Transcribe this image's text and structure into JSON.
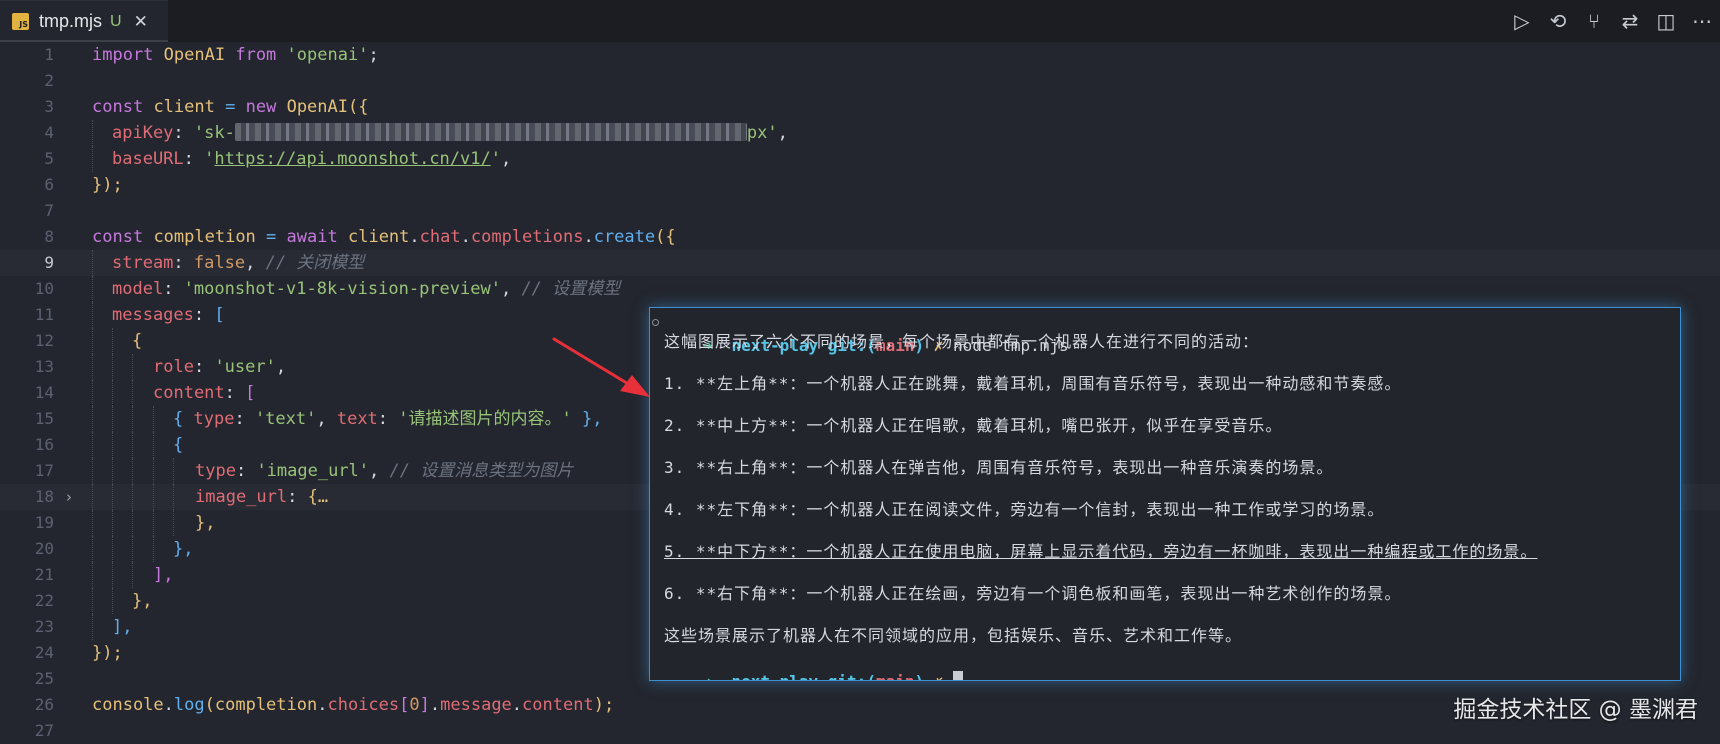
{
  "tab": {
    "icon_label": "JS",
    "filename": "tmp.mjs",
    "status": "U",
    "close_glyph": "✕"
  },
  "actions": [
    {
      "name": "run-icon",
      "glyph": "▷"
    },
    {
      "name": "history-icon",
      "glyph": "⟲"
    },
    {
      "name": "source-control-icon",
      "glyph": "⑂"
    },
    {
      "name": "compare-icon",
      "glyph": "⇄"
    },
    {
      "name": "split-editor-icon",
      "glyph": "◫"
    },
    {
      "name": "more-icon",
      "glyph": "⋯"
    }
  ],
  "editor": {
    "line_numbers": [
      "1",
      "2",
      "3",
      "4",
      "5",
      "6",
      "7",
      "8",
      "9",
      "10",
      "11",
      "12",
      "13",
      "14",
      "15",
      "16",
      "17",
      "18",
      "19",
      "20",
      "21",
      "22",
      "23",
      "24",
      "25",
      "26",
      "27",
      "28"
    ],
    "active_line": "9",
    "folded_line": "18",
    "code": {
      "l1": {
        "kw1": "import",
        "cls": "OpenAI",
        "kw2": "from",
        "str": "'openai'",
        "end": ";"
      },
      "l3": {
        "kw": "const",
        "var": "client",
        "op": "=",
        "kw2": "new",
        "cls": "OpenAI",
        "open": "({"
      },
      "l4": {
        "prop": "apiKey",
        "str_start": "'sk-",
        "str_end": "px'",
        "end": ","
      },
      "l5": {
        "prop": "baseURL",
        "q1": "'",
        "url": "https://api.moonshot.cn/v1/",
        "q2": "'",
        "end": ","
      },
      "l6": {
        "text": "});"
      },
      "l8": {
        "kw": "const",
        "var": "completion",
        "op": "=",
        "kw2": "await",
        "obj": "client",
        "p1": "chat",
        "p2": "completions",
        "fn": "create",
        "open": "({"
      },
      "l9": {
        "prop": "stream",
        "val": "false",
        "comment": "// 关闭模型"
      },
      "l10": {
        "prop": "model",
        "str": "'moonshot-v1-8k-vision-preview'",
        "comment": "// 设置模型"
      },
      "l11": {
        "prop": "messages",
        "open": "["
      },
      "l12": {
        "text": "{"
      },
      "l13": {
        "prop": "role",
        "str": "'user'"
      },
      "l14": {
        "prop": "content",
        "open": "["
      },
      "l15": {
        "prop1": "type",
        "str1": "'text'",
        "prop2": "text",
        "str2": "'请描述图片的内容。'"
      },
      "l16": {
        "text": "{"
      },
      "l17": {
        "prop": "type",
        "str": "'image_url'",
        "comment": "// 设置消息类型为图片"
      },
      "l18": {
        "prop": "image_url",
        "folded": "{…"
      },
      "l19": {
        "text": "},"
      },
      "l20": {
        "text": "},"
      },
      "l21": {
        "text": "],"
      },
      "l22": {
        "text": "},"
      },
      "l23": {
        "text": "],"
      },
      "l24": {
        "text": "});"
      },
      "l27": {
        "obj": "console",
        "fn": "log",
        "arg1": "completion",
        "arg2": "choices",
        "idx": "0",
        "arg3": "message",
        "arg4": "content",
        "end": ");"
      }
    }
  },
  "terminal": {
    "prompt_arrow": "➜",
    "dir": "next-play",
    "git_label": "git:(",
    "branch": "main",
    "git_close": ")",
    "dirty": "✗",
    "command": "node tmp.mjs",
    "output": [
      "这幅图展示了六个不同的场景，每个场景中都有一个机器人在进行不同的活动：",
      "1. **左上角**：一个机器人正在跳舞，戴着耳机，周围有音乐符号，表现出一种动感和节奏感。",
      "2. **中上方**：一个机器人正在唱歌，戴着耳机，嘴巴张开，似乎在享受音乐。",
      "3. **右上角**：一个机器人在弹吉他，周围有音乐符号，表现出一种音乐演奏的场景。",
      "4. **左下角**：一个机器人正在阅读文件，旁边有一个信封，表现出一种工作或学习的场景。",
      "5. **中下方**：一个机器人正在使用电脑，屏幕上显示着代码，旁边有一杯咖啡，表现出一种编程或工作的场景。",
      "6. **右下角**：一个机器人正在绘画，旁边有一个调色板和画笔，表现出一种艺术创作的场景。",
      "这些场景展示了机器人在不同领域的应用，包括娱乐、音乐、艺术和工作等。"
    ]
  },
  "watermark": "掘金技术社区 @ 墨渊君",
  "colors": {
    "accent_border": "#3d8fd1",
    "annotation_arrow": "#e8303a"
  }
}
